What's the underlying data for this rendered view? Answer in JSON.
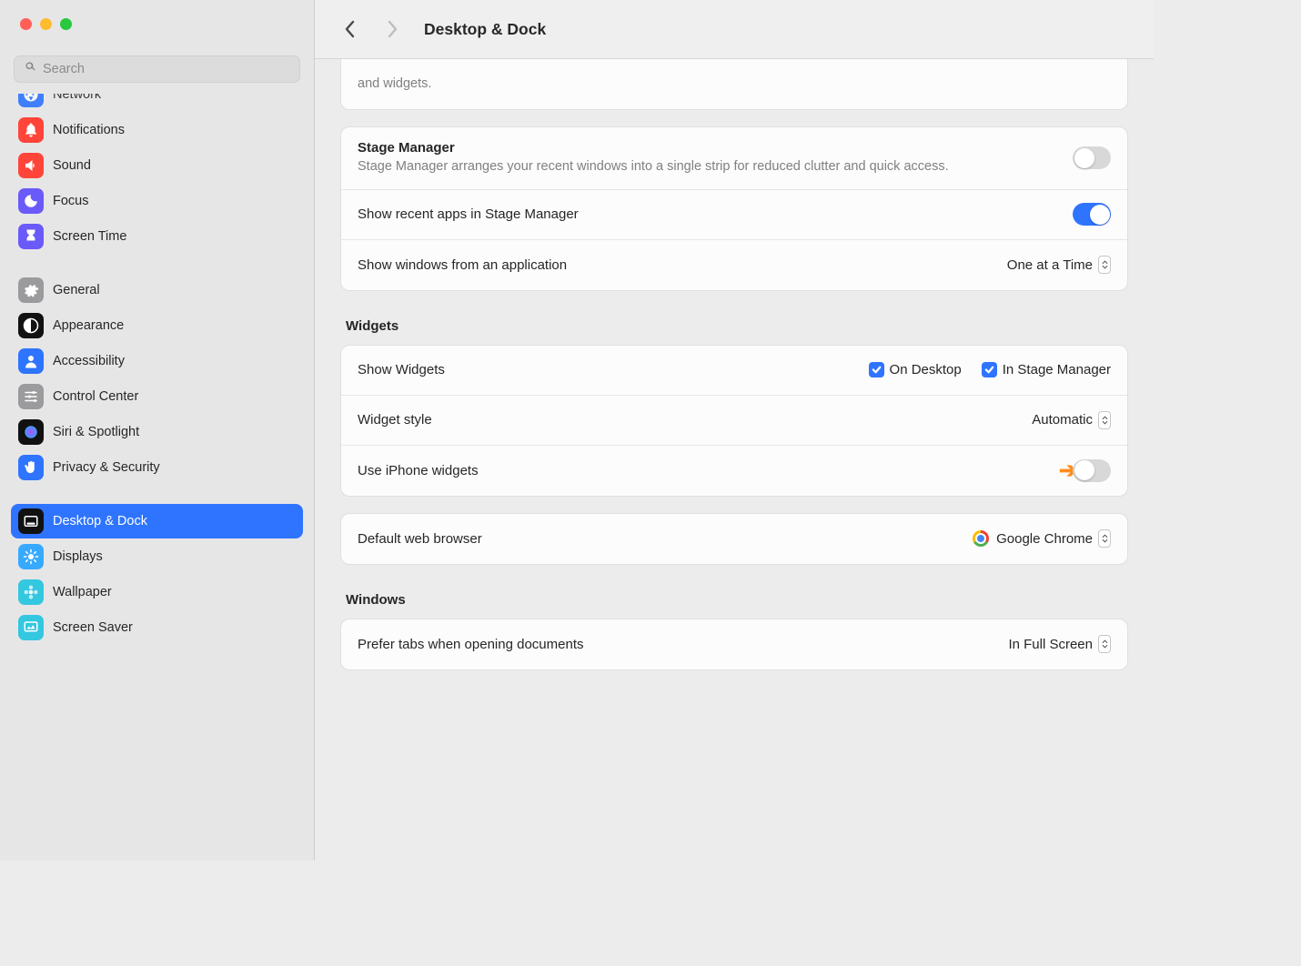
{
  "header": {
    "title": "Desktop & Dock",
    "search_placeholder": "Search"
  },
  "sidebar": {
    "items": [
      {
        "label": "Network",
        "icon": "globe",
        "bg": "#2e74ff",
        "partial": true
      },
      {
        "label": "Notifications",
        "icon": "bell",
        "bg": "#ff453a"
      },
      {
        "label": "Sound",
        "icon": "speaker",
        "bg": "#ff453a"
      },
      {
        "label": "Focus",
        "icon": "moon",
        "bg": "#6a5af9"
      },
      {
        "label": "Screen Time",
        "icon": "hourglass",
        "bg": "#6a5af9"
      },
      {
        "spacer": true
      },
      {
        "label": "General",
        "icon": "gear",
        "bg": "#9b9b9d"
      },
      {
        "label": "Appearance",
        "icon": "contrast",
        "bg": "#111111"
      },
      {
        "label": "Accessibility",
        "icon": "person",
        "bg": "#2e74ff"
      },
      {
        "label": "Control Center",
        "icon": "sliders",
        "bg": "#9b9b9d"
      },
      {
        "label": "Siri & Spotlight",
        "icon": "siri",
        "bg": "#111111"
      },
      {
        "label": "Privacy & Security",
        "icon": "hand",
        "bg": "#2e74ff"
      },
      {
        "spacer": true
      },
      {
        "label": "Desktop & Dock",
        "icon": "dock",
        "bg": "#111111",
        "selected": true
      },
      {
        "label": "Displays",
        "icon": "sun",
        "bg": "#37aaff"
      },
      {
        "label": "Wallpaper",
        "icon": "flower",
        "bg": "#34c7e0"
      },
      {
        "label": "Screen Saver",
        "icon": "screensaver",
        "bg": "#34c7e0"
      }
    ]
  },
  "main": {
    "cutoff_text": "and widgets.",
    "stage_manager": {
      "title": "Stage Manager",
      "desc": "Stage Manager arranges your recent windows into a single strip for reduced clutter and quick access.",
      "enabled": false,
      "recent_apps_label": "Show recent apps in Stage Manager",
      "recent_apps_enabled": true,
      "show_windows_label": "Show windows from an application",
      "show_windows_value": "One at a Time"
    },
    "widgets": {
      "header": "Widgets",
      "show_widgets_label": "Show Widgets",
      "on_desktop_label": "On Desktop",
      "on_desktop_checked": true,
      "in_stage_label": "In Stage Manager",
      "in_stage_checked": true,
      "widget_style_label": "Widget style",
      "widget_style_value": "Automatic",
      "iphone_label": "Use iPhone widgets",
      "iphone_enabled": false
    },
    "default_browser": {
      "label": "Default web browser",
      "value": "Google Chrome"
    },
    "windows": {
      "header": "Windows",
      "prefer_tabs_label": "Prefer tabs when opening documents",
      "prefer_tabs_value": "In Full Screen"
    }
  }
}
